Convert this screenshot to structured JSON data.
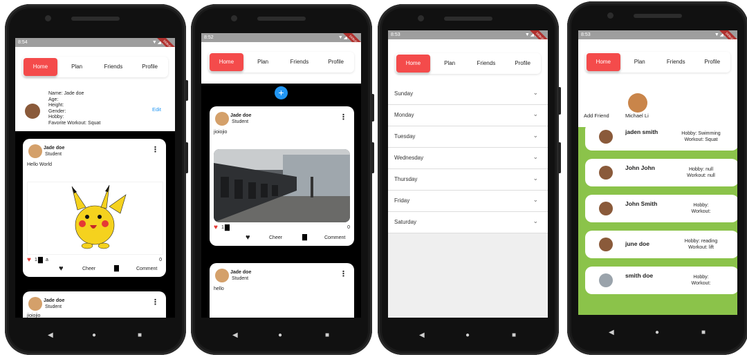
{
  "tabs": [
    "Home",
    "Plan",
    "Friends",
    "Profile"
  ],
  "phone1": {
    "time": "8:54",
    "profile": {
      "lines": [
        "Name:  Jade doe",
        "Age:",
        "Height:",
        "Gender:",
        "Hobby:",
        "Favorite Workout:  Squat"
      ],
      "edit": "Edit"
    },
    "post1": {
      "name": "Jade doe",
      "role": "Student",
      "text": "Hello World",
      "likes": "1",
      "comments": "a",
      "count": "0",
      "cheer": "Cheer",
      "comment": "Comment"
    },
    "post2": {
      "name": "Jade doe",
      "role": "Student",
      "text": "jioiojio"
    }
  },
  "phone2": {
    "time": "8:52",
    "add": "+",
    "post1": {
      "name": "Jade doe",
      "role": "Student",
      "text": "jioiojio",
      "likes": "1",
      "count": "0",
      "cheer": "Cheer",
      "comment": "Comment"
    },
    "post2": {
      "name": "Jade doe",
      "role": "Student",
      "text": "hello"
    }
  },
  "phone3": {
    "time": "8:53",
    "days": [
      "Sunday",
      "Monday",
      "Tuesday",
      "Wednesday",
      "Thursday",
      "Friday",
      "Saturday"
    ]
  },
  "phone4": {
    "time": "8:53",
    "add_friend": "Add Friend",
    "friend_top": "Michael Li",
    "friends": [
      {
        "name": "jaden smith",
        "hobby": "Hobby: Swimming",
        "workout": "Workout: Squat"
      },
      {
        "name": "John John",
        "hobby": "Hobby: null",
        "workout": "Workout: null"
      },
      {
        "name": "John Smith",
        "hobby": "Hobby:",
        "workout": "Workout:"
      },
      {
        "name": "june doe",
        "hobby": "Hobby: reading",
        "workout": "Workout: lift"
      },
      {
        "name": "smith doe",
        "hobby": "Hobby:",
        "workout": "Workout:"
      }
    ]
  },
  "debug_label": "DEBUG",
  "colors": {
    "accent": "#f44b4b",
    "green": "#8bc34a",
    "fab": "#2196f3"
  }
}
